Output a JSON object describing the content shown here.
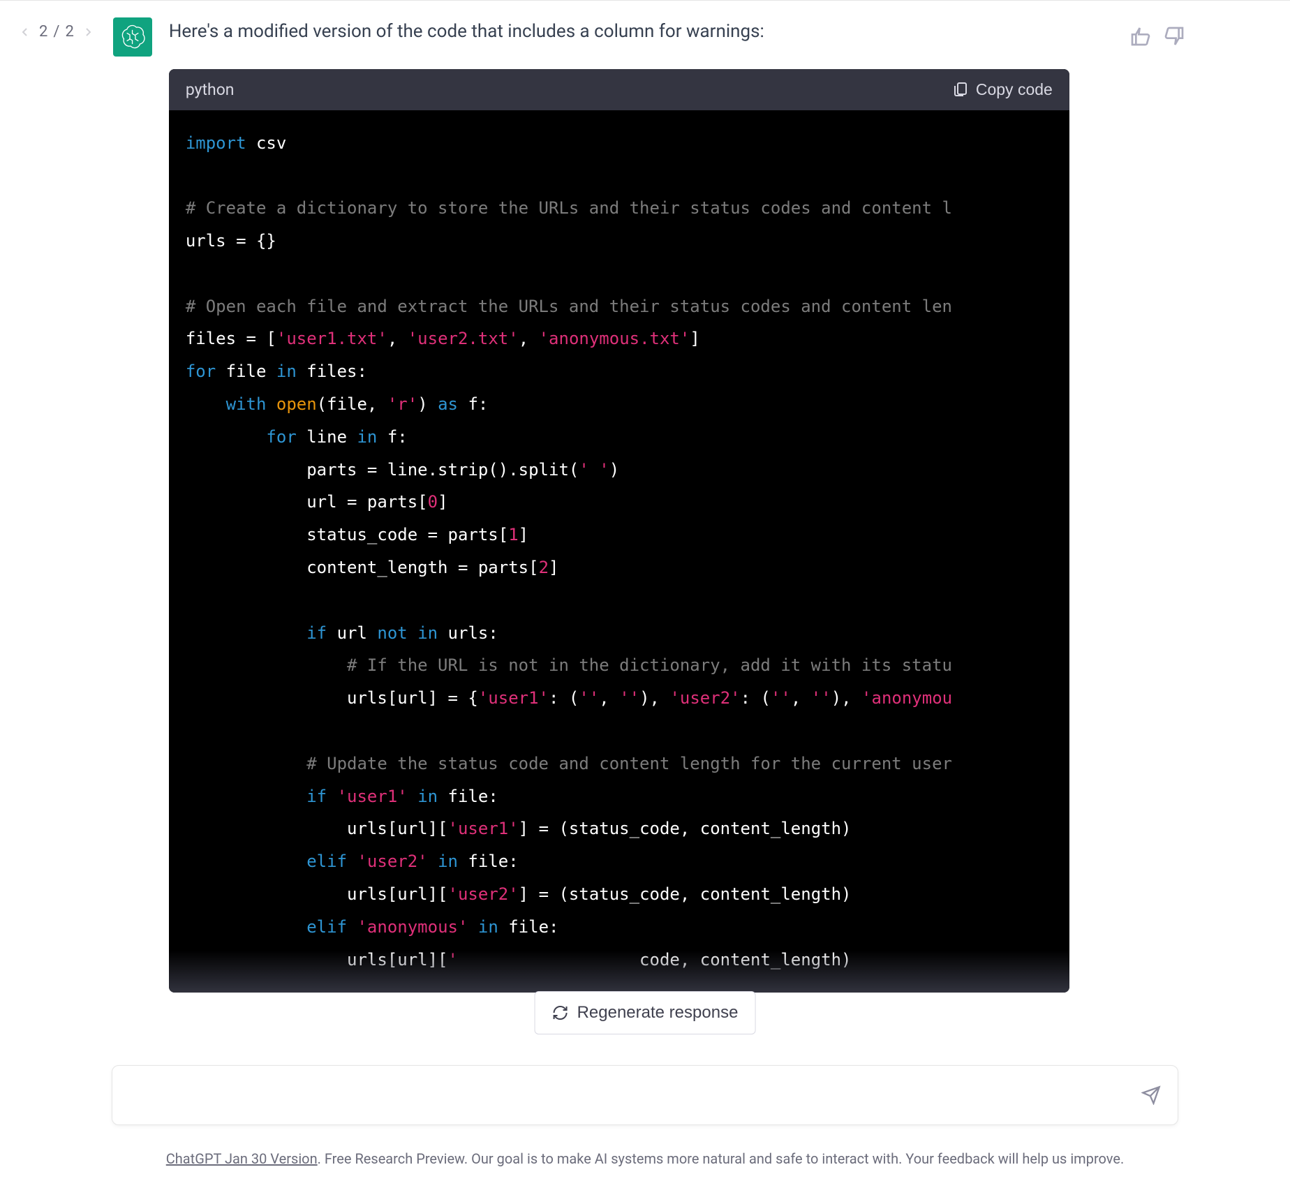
{
  "pagination": {
    "current": "2",
    "total": "2",
    "separator": "/"
  },
  "message": {
    "text": "Here's a modified version of the code that includes a column for warnings:"
  },
  "code": {
    "language": "python",
    "copy_label": "Copy code",
    "tokens": [
      {
        "t": "keyword",
        "v": "import"
      },
      {
        "t": "plain",
        "v": " csv\n\n"
      },
      {
        "t": "comment",
        "v": "# Create a dictionary to store the URLs and their status codes and content l"
      },
      {
        "t": "plain",
        "v": "\nurls = {}\n\n"
      },
      {
        "t": "comment",
        "v": "# Open each file and extract the URLs and their status codes and content len"
      },
      {
        "t": "plain",
        "v": "\nfiles = ["
      },
      {
        "t": "string",
        "v": "'user1.txt'"
      },
      {
        "t": "plain",
        "v": ", "
      },
      {
        "t": "string",
        "v": "'user2.txt'"
      },
      {
        "t": "plain",
        "v": ", "
      },
      {
        "t": "string",
        "v": "'anonymous.txt'"
      },
      {
        "t": "plain",
        "v": "]\n"
      },
      {
        "t": "keyword",
        "v": "for"
      },
      {
        "t": "plain",
        "v": " file "
      },
      {
        "t": "keyword",
        "v": "in"
      },
      {
        "t": "plain",
        "v": " files:\n    "
      },
      {
        "t": "keyword",
        "v": "with"
      },
      {
        "t": "plain",
        "v": " "
      },
      {
        "t": "builtin",
        "v": "open"
      },
      {
        "t": "plain",
        "v": "(file, "
      },
      {
        "t": "string",
        "v": "'r'"
      },
      {
        "t": "plain",
        "v": ") "
      },
      {
        "t": "keyword",
        "v": "as"
      },
      {
        "t": "plain",
        "v": " f:\n        "
      },
      {
        "t": "keyword",
        "v": "for"
      },
      {
        "t": "plain",
        "v": " line "
      },
      {
        "t": "keyword",
        "v": "in"
      },
      {
        "t": "plain",
        "v": " f:\n            parts = line.strip().split("
      },
      {
        "t": "string",
        "v": "' '"
      },
      {
        "t": "plain",
        "v": ")\n            url = parts["
      },
      {
        "t": "number",
        "v": "0"
      },
      {
        "t": "plain",
        "v": "]\n            status_code = parts["
      },
      {
        "t": "number",
        "v": "1"
      },
      {
        "t": "plain",
        "v": "]\n            content_length = parts["
      },
      {
        "t": "number",
        "v": "2"
      },
      {
        "t": "plain",
        "v": "]\n\n            "
      },
      {
        "t": "keyword",
        "v": "if"
      },
      {
        "t": "plain",
        "v": " url "
      },
      {
        "t": "keyword",
        "v": "not"
      },
      {
        "t": "plain",
        "v": " "
      },
      {
        "t": "keyword",
        "v": "in"
      },
      {
        "t": "plain",
        "v": " urls:\n                "
      },
      {
        "t": "comment",
        "v": "# If the URL is not in the dictionary, add it with its statu"
      },
      {
        "t": "plain",
        "v": "\n                urls[url] = {"
      },
      {
        "t": "string",
        "v": "'user1'"
      },
      {
        "t": "plain",
        "v": ": ("
      },
      {
        "t": "string",
        "v": "''"
      },
      {
        "t": "plain",
        "v": ", "
      },
      {
        "t": "string",
        "v": "''"
      },
      {
        "t": "plain",
        "v": "), "
      },
      {
        "t": "string",
        "v": "'user2'"
      },
      {
        "t": "plain",
        "v": ": ("
      },
      {
        "t": "string",
        "v": "''"
      },
      {
        "t": "plain",
        "v": ", "
      },
      {
        "t": "string",
        "v": "''"
      },
      {
        "t": "plain",
        "v": "), "
      },
      {
        "t": "string",
        "v": "'anonymou"
      },
      {
        "t": "plain",
        "v": "\n\n            "
      },
      {
        "t": "comment",
        "v": "# Update the status code and content length for the current user"
      },
      {
        "t": "plain",
        "v": "\n            "
      },
      {
        "t": "keyword",
        "v": "if"
      },
      {
        "t": "plain",
        "v": " "
      },
      {
        "t": "string",
        "v": "'user1'"
      },
      {
        "t": "plain",
        "v": " "
      },
      {
        "t": "keyword",
        "v": "in"
      },
      {
        "t": "plain",
        "v": " file:\n                urls[url]["
      },
      {
        "t": "string",
        "v": "'user1'"
      },
      {
        "t": "plain",
        "v": "] = (status_code, content_length)\n            "
      },
      {
        "t": "keyword",
        "v": "elif"
      },
      {
        "t": "plain",
        "v": " "
      },
      {
        "t": "string",
        "v": "'user2'"
      },
      {
        "t": "plain",
        "v": " "
      },
      {
        "t": "keyword",
        "v": "in"
      },
      {
        "t": "plain",
        "v": " file:\n                urls[url]["
      },
      {
        "t": "string",
        "v": "'user2'"
      },
      {
        "t": "plain",
        "v": "] = (status_code, content_length)\n            "
      },
      {
        "t": "keyword",
        "v": "elif"
      },
      {
        "t": "plain",
        "v": " "
      },
      {
        "t": "string",
        "v": "'anonymous'"
      },
      {
        "t": "plain",
        "v": " "
      },
      {
        "t": "keyword",
        "v": "in"
      },
      {
        "t": "plain",
        "v": " file:\n                urls[url]["
      },
      {
        "t": "string",
        "v": "'"
      },
      {
        "t": "plain",
        "v": "                  code, content_length)"
      }
    ]
  },
  "regenerate": {
    "label": "Regenerate response"
  },
  "input": {
    "placeholder": ""
  },
  "footer": {
    "version_link": "ChatGPT Jan 30 Version",
    "text": ". Free Research Preview. Our goal is to make AI systems more natural and safe to interact with. Your feedback will help us improve."
  }
}
